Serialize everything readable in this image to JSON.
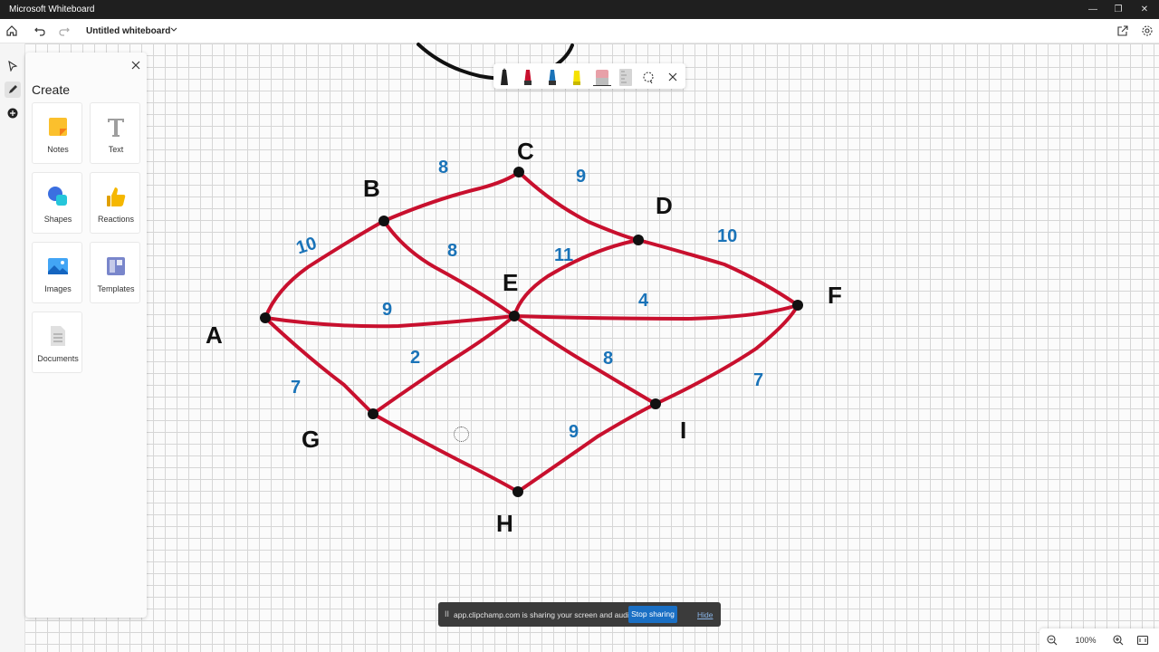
{
  "window": {
    "title": "Microsoft Whiteboard"
  },
  "appbar": {
    "document_title": "Untitled whiteboard"
  },
  "create_panel": {
    "title": "Create",
    "tiles": [
      {
        "label": "Notes",
        "icon": "sticky-note-icon"
      },
      {
        "label": "Text",
        "icon": "text-icon"
      },
      {
        "label": "Shapes",
        "icon": "shapes-icon"
      },
      {
        "label": "Reactions",
        "icon": "thumbs-up-icon"
      },
      {
        "label": "Images",
        "icon": "image-icon"
      },
      {
        "label": "Templates",
        "icon": "templates-icon"
      },
      {
        "label": "Documents",
        "icon": "document-icon"
      }
    ]
  },
  "pen_tray": {
    "pens": [
      {
        "name": "black-pen",
        "color": "#1b1b1b"
      },
      {
        "name": "red-pen",
        "color": "#c8102e"
      },
      {
        "name": "blue-pen",
        "color": "#1a73b8"
      },
      {
        "name": "yellow-highlighter",
        "color": "#f5e100"
      },
      {
        "name": "eraser",
        "color": "#e8a0a8"
      },
      {
        "name": "ruler",
        "color": "#c9c9c9"
      }
    ]
  },
  "graph": {
    "edge_color": "#c8102e",
    "nodes": [
      {
        "id": "A",
        "label": "A"
      },
      {
        "id": "B",
        "label": "B"
      },
      {
        "id": "C",
        "label": "C"
      },
      {
        "id": "D",
        "label": "D"
      },
      {
        "id": "E",
        "label": "E"
      },
      {
        "id": "F",
        "label": "F"
      },
      {
        "id": "G",
        "label": "G"
      },
      {
        "id": "H",
        "label": "H"
      },
      {
        "id": "I",
        "label": "I"
      }
    ],
    "edges": [
      {
        "from": "A",
        "to": "B",
        "weight": "10"
      },
      {
        "from": "B",
        "to": "C",
        "weight": "8"
      },
      {
        "from": "C",
        "to": "D",
        "weight": "9"
      },
      {
        "from": "D",
        "to": "F",
        "weight": "10"
      },
      {
        "from": "B",
        "to": "E",
        "weight": "8"
      },
      {
        "from": "E",
        "to": "D",
        "weight": "11"
      },
      {
        "from": "A",
        "to": "E",
        "weight": "9"
      },
      {
        "from": "E",
        "to": "F",
        "weight": "4"
      },
      {
        "from": "A",
        "to": "G",
        "weight": "7"
      },
      {
        "from": "G",
        "to": "E",
        "weight": "2"
      },
      {
        "from": "E",
        "to": "I",
        "weight": "8"
      },
      {
        "from": "I",
        "to": "F",
        "weight": "7"
      },
      {
        "from": "G",
        "to": "H",
        "weight": ""
      },
      {
        "from": "H",
        "to": "I",
        "weight": "9"
      }
    ]
  },
  "share_bar": {
    "pause_symbol": "II",
    "message": "app.clipchamp.com is sharing your screen and audio.",
    "stop_label": "Stop sharing",
    "hide_label": "Hide"
  },
  "zoom": {
    "level": "100%"
  }
}
